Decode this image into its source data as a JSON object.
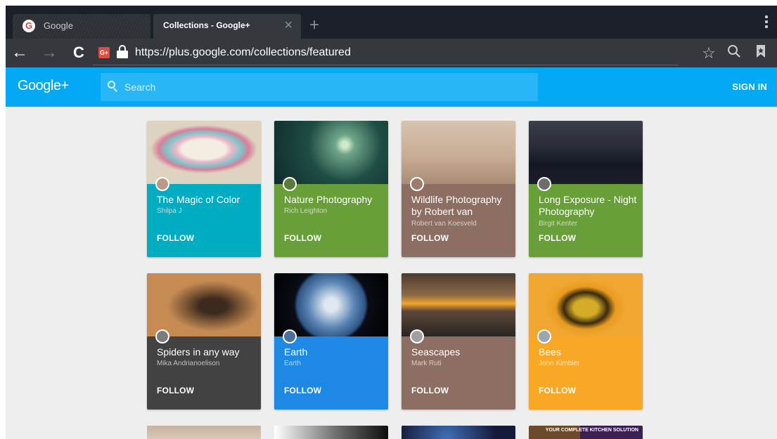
{
  "browser": {
    "tabs": [
      {
        "title": "Google",
        "favicon": "google-g-icon"
      },
      {
        "title": "Collections - Google+",
        "close_icon": "close-icon"
      }
    ],
    "new_tab_icon": "plus-icon",
    "menu_icon": "vertical-dots-icon",
    "url": "https://plus.google.com/collections/featured",
    "icons": {
      "back": "arrow-left-icon",
      "forward": "arrow-right-icon",
      "reload": "reload-icon",
      "site": "google-plus-site-icon",
      "lock": "lock-icon",
      "star": "star-icon",
      "search": "search-icon",
      "bookmark": "bookmark-icon"
    }
  },
  "header": {
    "logo": "Google+",
    "search_placeholder": "Search",
    "sign_in": "SIGN IN",
    "color": "#03a9f4"
  },
  "collections": [
    {
      "title": "The Magic of Color",
      "owner": "Shilpa J",
      "follow": "FOLLOW",
      "color": "#00acc1"
    },
    {
      "title": "Nature Photography",
      "owner": "Rich Leighton",
      "follow": "FOLLOW",
      "color": "#689f38"
    },
    {
      "title": "Wildlife Photography by Robert van",
      "owner": "Robert van Koesveld",
      "follow": "FOLLOW",
      "color": "#8d6e63"
    },
    {
      "title": "Long Exposure - Night Photography",
      "owner": "Birgit Kenter",
      "follow": "FOLLOW",
      "color": "#689f38"
    },
    {
      "title": "Spiders in any way",
      "owner": "Mika Andrianoelison",
      "follow": "FOLLOW",
      "color": "#424242"
    },
    {
      "title": "Earth",
      "owner": "Earth",
      "follow": "FOLLOW",
      "color": "#1e88e5"
    },
    {
      "title": "Seascapes",
      "owner": "Mark Ruti",
      "follow": "FOLLOW",
      "color": "#8d6e63"
    },
    {
      "title": "Bees",
      "owner": "John Kimbler",
      "follow": "FOLLOW",
      "color": "#f9a825"
    }
  ],
  "partial_row": {
    "promo_text": "YOUR COMPLETE KITCHEN SOLUTION"
  }
}
